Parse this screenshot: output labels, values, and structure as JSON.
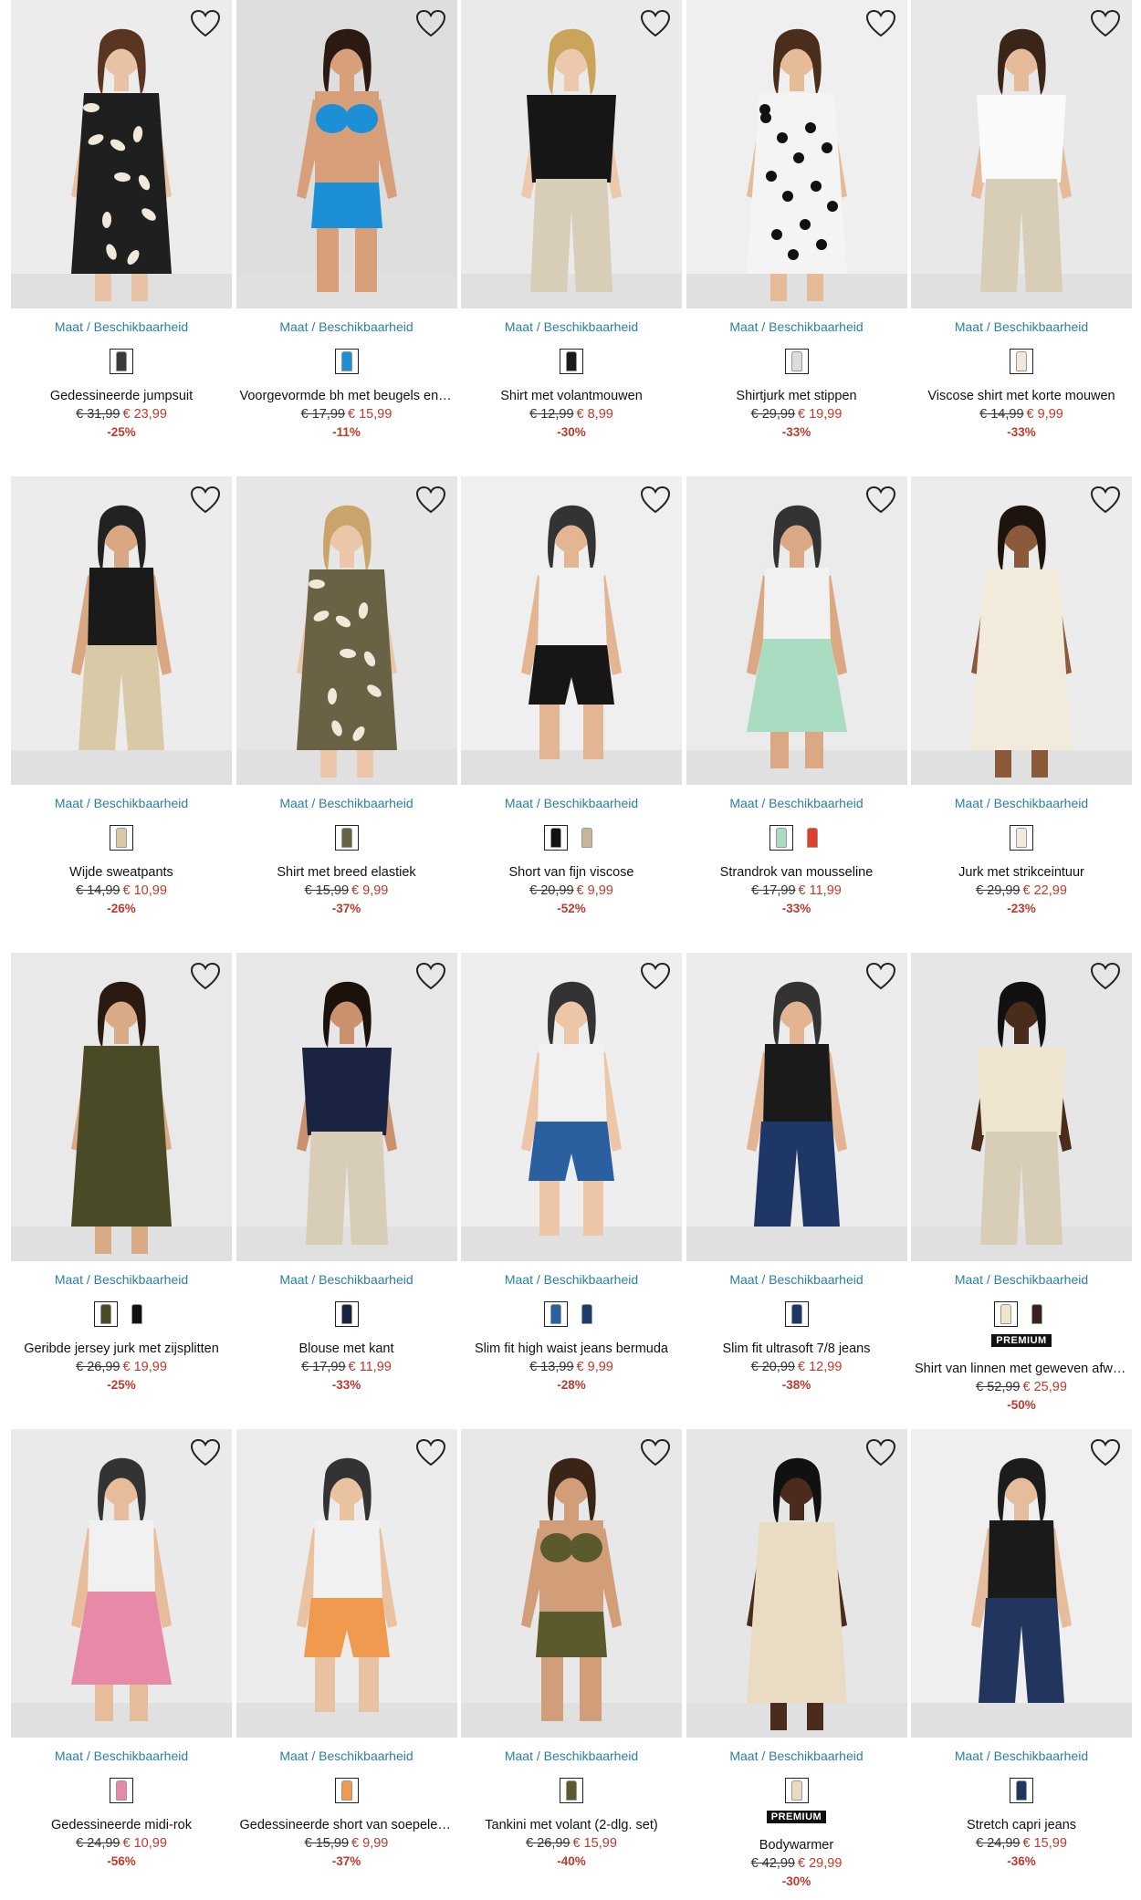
{
  "size_link_label": "Maat / Beschikbaarheid",
  "products": [
    {
      "name": "Gedessineerde jumpsuit",
      "old": "€ 31,99",
      "new": "€ 23,99",
      "disc": "-25%",
      "bg": "#ececec",
      "garment": "#1f1f1f",
      "skin": "#e7c2a4",
      "hair": "#5a3522",
      "style": "pattern",
      "swatches": [
        "#3a3a3a"
      ],
      "badge": ""
    },
    {
      "name": "Voorgevormde bh met beugels en g…",
      "old": "€ 17,99",
      "new": "€ 15,99",
      "disc": "-11%",
      "bg": "#dedede",
      "garment": "#1c8fd6",
      "skin": "#d7a07b",
      "hair": "#2b1a12",
      "style": "bra",
      "swatches": [
        "#1c8fd6"
      ],
      "badge": ""
    },
    {
      "name": "Shirt met volantmouwen",
      "old": "€ 12,99",
      "new": "€ 8,99",
      "disc": "-30%",
      "bg": "#eaeaea",
      "garment": "#161616",
      "skin": "#ecc9ac",
      "hair": "#c9a45a",
      "style": "top",
      "swatches": [
        "#1a1a1a"
      ],
      "badge": ""
    },
    {
      "name": "Shirtjurk met stippen",
      "old": "€ 29,99",
      "new": "€ 19,99",
      "disc": "-33%",
      "bg": "#efefef",
      "garment": "#f4f4f4",
      "skin": "#e6bb98",
      "hair": "#4a2e1b",
      "style": "dots",
      "swatches": [
        "#dcdcdc"
      ],
      "badge": ""
    },
    {
      "name": "Viscose shirt met korte mouwen",
      "old": "€ 14,99",
      "new": "€ 9,99",
      "disc": "-33%",
      "bg": "#e8e8e8",
      "garment": "#fafafa",
      "skin": "#e5bb9a",
      "hair": "#3b2418",
      "style": "tee",
      "swatches": [
        "#f3e6da"
      ],
      "badge": ""
    },
    {
      "name": "Wijde sweatpants",
      "old": "€ 14,99",
      "new": "€ 10,99",
      "disc": "-26%",
      "bg": "#ececec",
      "garment": "#d9c9a6",
      "skin": "#d9a883",
      "hair": "#222",
      "style": "pants",
      "swatches": [
        "#d9c9a6"
      ],
      "badge": ""
    },
    {
      "name": "Shirt met breed elastiek",
      "old": "€ 15,99",
      "new": "€ 9,99",
      "disc": "-37%",
      "bg": "#e6e6e6",
      "garment": "#6a6245",
      "skin": "#ebc6a8",
      "hair": "#c9a46b",
      "style": "pattern",
      "swatches": [
        "#6a6245"
      ],
      "badge": ""
    },
    {
      "name": "Short van fijn viscose",
      "old": "€ 20,99",
      "new": "€ 9,99",
      "disc": "-52%",
      "bg": "#efefef",
      "garment": "#161616",
      "skin": "#e3b592",
      "hair": "#333",
      "style": "shorts",
      "swatches": [
        "#111111",
        "#c9b39a"
      ],
      "badge": ""
    },
    {
      "name": "Strandrok van mousseline",
      "old": "€ 17,99",
      "new": "€ 11,99",
      "disc": "-33%",
      "bg": "#ebebeb",
      "garment": "#a9dcc0",
      "skin": "#dba884",
      "hair": "#333",
      "style": "skirt",
      "swatches": [
        "#a9dcc0",
        "#e0412d"
      ],
      "badge": ""
    },
    {
      "name": "Jurk met strikceintuur",
      "old": "€ 29,99",
      "new": "€ 22,99",
      "disc": "-23%",
      "bg": "#ececec",
      "garment": "#f2eadb",
      "skin": "#8a5a3b",
      "hair": "#1e140e",
      "style": "dress",
      "swatches": [
        "#f2eadb"
      ],
      "badge": ""
    },
    {
      "name": "Geribde jersey jurk met zijsplitten",
      "old": "€ 26,99",
      "new": "€ 19,99",
      "disc": "-25%",
      "bg": "#e9e9e9",
      "garment": "#4b4a26",
      "skin": "#d9aa86",
      "hair": "#2a1a10",
      "style": "dress",
      "swatches": [
        "#4b4a26",
        "#111111"
      ],
      "badge": ""
    },
    {
      "name": "Blouse met kant",
      "old": "€ 17,99",
      "new": "€ 11,99",
      "disc": "-33%",
      "bg": "#e7e7e7",
      "garment": "#1a2442",
      "skin": "#c9916d",
      "hair": "#1b120c",
      "style": "top",
      "swatches": [
        "#1a2442"
      ],
      "badge": ""
    },
    {
      "name": "Slim fit high waist jeans bermuda",
      "old": "€ 13,99",
      "new": "€ 9,99",
      "disc": "-28%",
      "bg": "#eeeeee",
      "garment": "#2a5fa0",
      "skin": "#ecc6a6",
      "hair": "#333",
      "style": "shorts",
      "swatches": [
        "#2a5fa0",
        "#1f3b6a"
      ],
      "badge": ""
    },
    {
      "name": "Slim fit ultrasoft 7/8 jeans",
      "old": "€ 20,99",
      "new": "€ 12,99",
      "disc": "-38%",
      "bg": "#ececec",
      "garment": "#1f3766",
      "skin": "#e3b491",
      "hair": "#333",
      "style": "pants",
      "swatches": [
        "#1f3766"
      ],
      "badge": ""
    },
    {
      "name": "Shirt van linnen met geweven afwe…",
      "old": "€ 52,99",
      "new": "€ 25,99",
      "disc": "-50%",
      "bg": "#e6e6e6",
      "garment": "#f0e6cf",
      "skin": "#4a2c1d",
      "hair": "#111",
      "style": "tee",
      "swatches": [
        "#f0e6cf",
        "#3a231c"
      ],
      "badge": "PREMIUM"
    },
    {
      "name": "Gedessineerde midi-rok",
      "old": "€ 24,99",
      "new": "€ 10,99",
      "disc": "-56%",
      "bg": "#eaeaea",
      "garment": "#e68aa8",
      "skin": "#e6bc9b",
      "hair": "#333",
      "style": "skirt",
      "swatches": [
        "#e68aa8"
      ],
      "badge": ""
    },
    {
      "name": "Gedessineerde short van soepele vi…",
      "old": "€ 15,99",
      "new": "€ 9,99",
      "disc": "-37%",
      "bg": "#ececec",
      "garment": "#ef9a4e",
      "skin": "#e9c2a1",
      "hair": "#333",
      "style": "shorts",
      "swatches": [
        "#ef9a4e"
      ],
      "badge": ""
    },
    {
      "name": "Tankini met volant (2-dlg. set)",
      "old": "€ 26,99",
      "new": "€ 15,99",
      "disc": "-40%",
      "bg": "#e8e8e8",
      "garment": "#5b5a2c",
      "skin": "#d19e79",
      "hair": "#3a2416",
      "style": "bra",
      "swatches": [
        "#5b5a2c"
      ],
      "badge": ""
    },
    {
      "name": "Bodywarmer",
      "old": "€ 42,99",
      "new": "€ 29,99",
      "disc": "-30%",
      "bg": "#e6e6e6",
      "garment": "#e9dcc2",
      "skin": "#4a2b1c",
      "hair": "#111",
      "style": "dress",
      "swatches": [
        "#e9dcc2"
      ],
      "badge": "PREMIUM"
    },
    {
      "name": "Stretch capri jeans",
      "old": "€ 24,99",
      "new": "€ 15,99",
      "disc": "-36%",
      "bg": "#efefef",
      "garment": "#21355f",
      "skin": "#e6bd9c",
      "hair": "#1c1c1c",
      "style": "pants",
      "swatches": [
        "#21355f"
      ],
      "badge": ""
    }
  ]
}
